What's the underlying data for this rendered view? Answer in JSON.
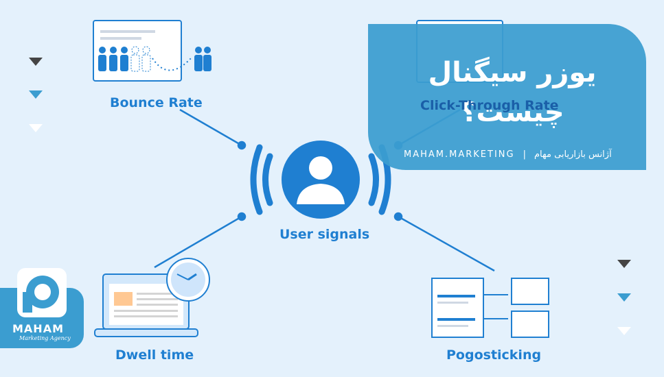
{
  "diagram": {
    "center_label": "User signals",
    "nodes": [
      {
        "label": "Bounce Rate"
      },
      {
        "label": "Click-Through Rate"
      },
      {
        "label": "Dwell time"
      },
      {
        "label": "Pogosticking"
      }
    ]
  },
  "banner": {
    "title_line1": "یوزر سیگنال",
    "title_line2": "چیست؟",
    "site": "MAHAM.MARKETING",
    "separator": "|",
    "agency": "آژانس بازاریابی مهام"
  },
  "logo": {
    "name": "MAHAM",
    "tagline": "Marketing Agency"
  },
  "colors": {
    "background": "#e4f1fc",
    "accent": "#1f7fd1",
    "panel": "#3b9dd0",
    "dark_triangle": "#444444"
  },
  "icons": [
    "user-icon",
    "browser-window-icon",
    "laptop-icon",
    "clock-icon",
    "cursor-click-icon",
    "search-results-icon",
    "triangle-icon"
  ]
}
